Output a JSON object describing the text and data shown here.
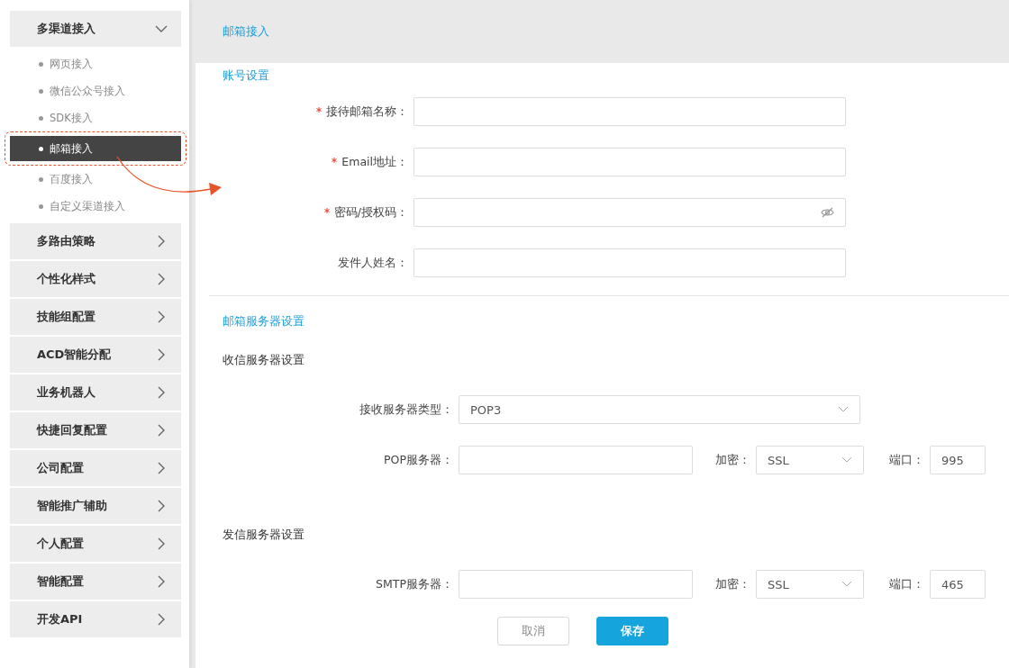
{
  "sidebar": {
    "groups": [
      {
        "label": "多渠道接入",
        "expanded": true,
        "children": [
          {
            "label": "网页接入",
            "selected": false
          },
          {
            "label": "微信公众号接入",
            "selected": false
          },
          {
            "label": "SDK接入",
            "selected": false
          },
          {
            "label": "邮箱接入",
            "selected": true
          },
          {
            "label": "百度接入",
            "selected": false
          },
          {
            "label": "自定义渠道接入",
            "selected": false
          }
        ]
      },
      {
        "label": "多路由策略",
        "expanded": false
      },
      {
        "label": "个性化样式",
        "expanded": false
      },
      {
        "label": "技能组配置",
        "expanded": false
      },
      {
        "label": "ACD智能分配",
        "expanded": false
      },
      {
        "label": "业务机器人",
        "expanded": false
      },
      {
        "label": "快捷回复配置",
        "expanded": false
      },
      {
        "label": "公司配置",
        "expanded": false
      },
      {
        "label": "智能推广辅助",
        "expanded": false
      },
      {
        "label": "个人配置",
        "expanded": false
      },
      {
        "label": "智能配置",
        "expanded": false
      },
      {
        "label": "开发API",
        "expanded": false
      }
    ]
  },
  "header": {
    "breadcrumb": "邮箱接入"
  },
  "account_section": {
    "title": "账号设置",
    "fields": [
      {
        "label": "接待邮箱名称：",
        "required": true,
        "kind": "text"
      },
      {
        "label": "Email地址：",
        "required": true,
        "kind": "text"
      },
      {
        "label": "密码/授权码：",
        "required": true,
        "kind": "password"
      },
      {
        "label": "发件人姓名：",
        "required": false,
        "kind": "text"
      }
    ]
  },
  "server_section": {
    "title": "邮箱服务器设置",
    "incoming": {
      "title": "收信服务器设置",
      "type_label": "接收服务器类型：",
      "type_value": "POP3",
      "server": {
        "label": "POP服务器：",
        "encryption_label": "加密：",
        "encryption_value": "SSL",
        "port_label": "端口：",
        "port_value": "995"
      }
    },
    "outgoing": {
      "title": "发信服务器设置",
      "server": {
        "label": "SMTP服务器：",
        "encryption_label": "加密：",
        "encryption_value": "SSL",
        "port_label": "端口：",
        "port_value": "465"
      }
    }
  },
  "buttons": [
    {
      "label": "取消",
      "kind": "secondary"
    },
    {
      "label": "保存",
      "kind": "primary"
    }
  ]
}
